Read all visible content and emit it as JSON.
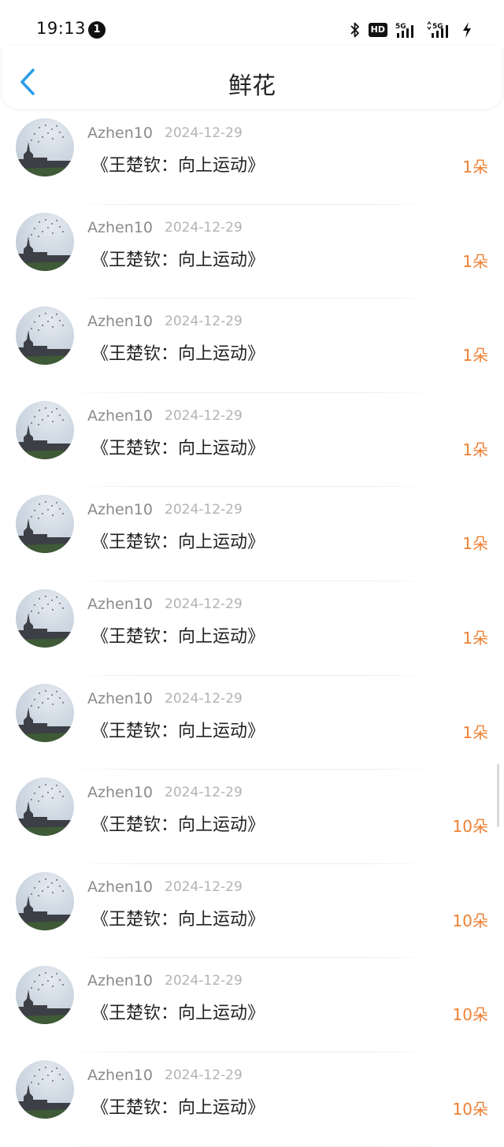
{
  "status_bar": {
    "time": "19:13",
    "notification_count": "1",
    "hd_label": "HD",
    "network_1": "5G",
    "network_2": "5G"
  },
  "header": {
    "title": "鲜花",
    "accent_color": "#2a9ce8"
  },
  "list": {
    "count_color": "#ee8033",
    "items": [
      {
        "user": "Azhen10",
        "date": "2024-12-29",
        "title": "《王楚钦：向上运动》",
        "count": "1朵"
      },
      {
        "user": "Azhen10",
        "date": "2024-12-29",
        "title": "《王楚钦：向上运动》",
        "count": "1朵"
      },
      {
        "user": "Azhen10",
        "date": "2024-12-29",
        "title": "《王楚钦：向上运动》",
        "count": "1朵"
      },
      {
        "user": "Azhen10",
        "date": "2024-12-29",
        "title": "《王楚钦：向上运动》",
        "count": "1朵"
      },
      {
        "user": "Azhen10",
        "date": "2024-12-29",
        "title": "《王楚钦：向上运动》",
        "count": "1朵"
      },
      {
        "user": "Azhen10",
        "date": "2024-12-29",
        "title": "《王楚钦：向上运动》",
        "count": "1朵"
      },
      {
        "user": "Azhen10",
        "date": "2024-12-29",
        "title": "《王楚钦：向上运动》",
        "count": "1朵"
      },
      {
        "user": "Azhen10",
        "date": "2024-12-29",
        "title": "《王楚钦：向上运动》",
        "count": "10朵"
      },
      {
        "user": "Azhen10",
        "date": "2024-12-29",
        "title": "《王楚钦：向上运动》",
        "count": "10朵"
      },
      {
        "user": "Azhen10",
        "date": "2024-12-29",
        "title": "《王楚钦：向上运动》",
        "count": "10朵"
      },
      {
        "user": "Azhen10",
        "date": "2024-12-29",
        "title": "《王楚钦：向上运动》",
        "count": "10朵"
      }
    ]
  }
}
